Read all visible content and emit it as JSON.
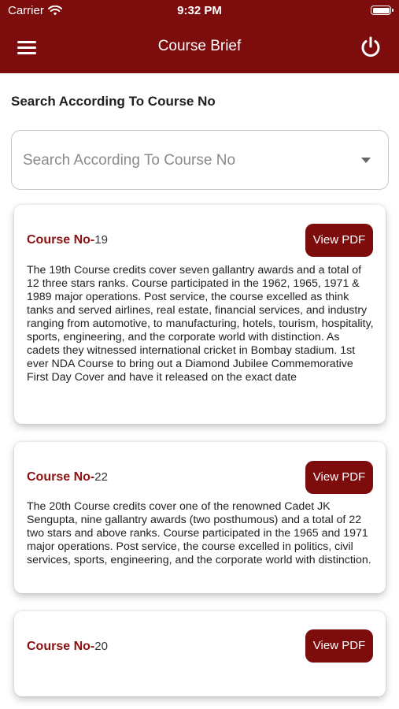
{
  "status_bar": {
    "carrier": "Carrier",
    "time": "9:32 PM"
  },
  "header": {
    "title": "Course Brief"
  },
  "search": {
    "label": "Search According To Course No",
    "placeholder": "Search According To Course No"
  },
  "courses": [
    {
      "prefix": "Course No-",
      "number": "19",
      "button": "View PDF",
      "description": "The 19th Course credits cover seven gallantry awards and a total of 12 three stars ranks. Course participated in the 1962, 1965, 1971 & 1989 major operations. Post service, the course excelled as think tanks and served airlines, real estate, financial services, and industry ranging from automotive, to manufacturing, hotels, tourism, hospitality, sports, engineering, and the corporate world with distinction. As cadets they witnessed international cricket in Bombay stadium. 1st ever NDA Course to bring out a Diamond Jubilee Commemorative First Day Cover and have it released on the exact date"
    },
    {
      "prefix": "Course No-",
      "number": "22",
      "button": "View PDF",
      "description": "The 20th Course credits cover one of the renowned Cadet JK Sengupta, nine gallantry awards (two posthumous) and a total of 22 two stars and above ranks. Course participated in the 1965 and 1971 major operations. Post service, the course excelled in politics, civil services, sports, engineering, and the corporate world with distinction."
    },
    {
      "prefix": "Course No-",
      "number": "20",
      "button": "View PDF",
      "description": ""
    }
  ]
}
